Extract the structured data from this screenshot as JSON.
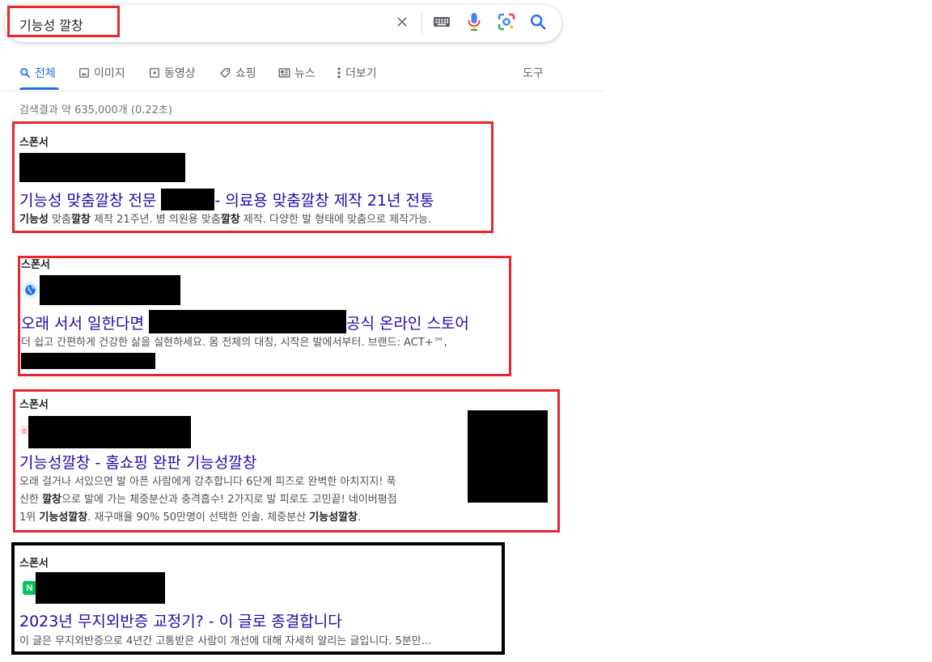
{
  "search": {
    "query": "기능성 깔창"
  },
  "tabs": [
    {
      "label": "전체",
      "icon": "search-icon",
      "active": true
    },
    {
      "label": "이미지",
      "icon": "image-icon"
    },
    {
      "label": "동영상",
      "icon": "play-icon"
    },
    {
      "label": "쇼핑",
      "icon": "tag-icon"
    },
    {
      "label": "뉴스",
      "icon": "news-icon"
    },
    {
      "label": "더보기",
      "icon": "more-vert-icon"
    }
  ],
  "tools_label": "도구",
  "result_stats": "검색결과 약 635,000개 (0.22초)",
  "ads": [
    {
      "sponsor": "스폰서",
      "title_a": "기능성 맞춤깔창 전문 ",
      "title_b": "- 의료용 맞춤깔창 제작 21년 전통",
      "desc_lines": [
        [
          {
            "t": "기능성",
            "b": true
          },
          {
            "t": " 맞춤"
          },
          {
            "t": "깔창",
            "b": true
          },
          {
            "t": " 제작 21주년. 병 의원용 맞춤"
          },
          {
            "t": "깔창",
            "b": true
          },
          {
            "t": " 제작. 다양한 발 형태에 맞춤으로 제작가능."
          }
        ]
      ]
    },
    {
      "sponsor": "스폰서",
      "title_a": "오래 서서 일한다면 ",
      "title_b": "공식 온라인 스토어",
      "desc_lines": [
        [
          {
            "t": "더 쉽고 간편하게 건강한 삶을 실현하세요. 몸 전체의 대칭, 시작은 발에서부터. 브랜드: ACT+™,"
          }
        ]
      ]
    },
    {
      "sponsor": "스폰서",
      "title_a": "기능성깔창 - 홈쇼핑 완판 기능성깔창",
      "desc_lines": [
        [
          {
            "t": "오래 걸거나 서있으면 발 아픈 사람에게 강추합니다 6단계 피즈로 완벽한 아치지지! 푹"
          }
        ],
        [
          {
            "t": "신한 "
          },
          {
            "t": "깔창",
            "b": true
          },
          {
            "t": "으로 발에 가는 체중분산과 충격흡수! 2가지로 발 피로도 고민끝! 네이버평점"
          }
        ],
        [
          {
            "t": "1위 "
          },
          {
            "t": "기능성깔창",
            "b": true
          },
          {
            "t": ". 재구매율 90% 50만명이 선택한 인솔. 체중분산 "
          },
          {
            "t": "기능성깔창",
            "b": true
          },
          {
            "t": "."
          }
        ]
      ]
    },
    {
      "sponsor": "스폰서",
      "favicon_letter": "N",
      "title_a": "2023년 무지외반증 교정기? - 이 글로 종결합니다",
      "desc_lines": [
        [
          {
            "t": "이 글은 무지외반증으로 4년간 고통받은 사람이 개선에 대해 자세히 알리는 글입니다. 5분만..."
          }
        ]
      ]
    }
  ],
  "colors": {
    "link": "#1a0dab",
    "accent": "#1a73e8",
    "highlight_red": "#e8262d",
    "naver_green": "#03c75a"
  }
}
